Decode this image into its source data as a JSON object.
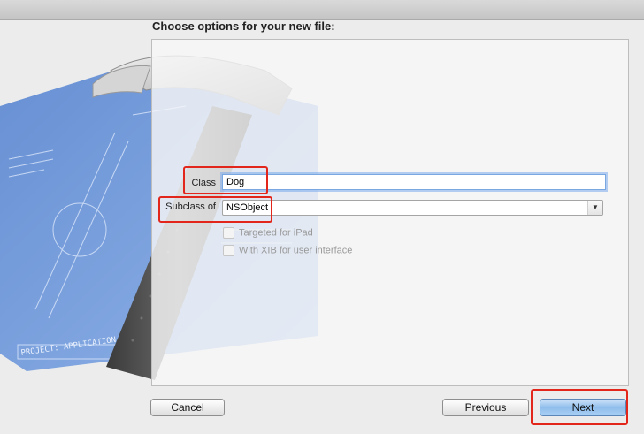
{
  "sheet": {
    "title": "Choose options for your new file:"
  },
  "form": {
    "class_label": "Class",
    "class_value": "Dog",
    "subclass_label": "Subclass of",
    "subclass_value": "NSObject",
    "targeted_ipad_label": "Targeted for iPad",
    "targeted_ipad_checked": false,
    "xib_label": "With XIB for user interface",
    "xib_checked": false
  },
  "buttons": {
    "cancel": "Cancel",
    "previous": "Previous",
    "next": "Next"
  },
  "artwork": {
    "blueprint_text": "PROJECT: APPLICATION.APP"
  },
  "colors": {
    "highlight": "#e3261b",
    "blueprint": "#5b8fdc",
    "default_button": "#8fbdeb"
  }
}
